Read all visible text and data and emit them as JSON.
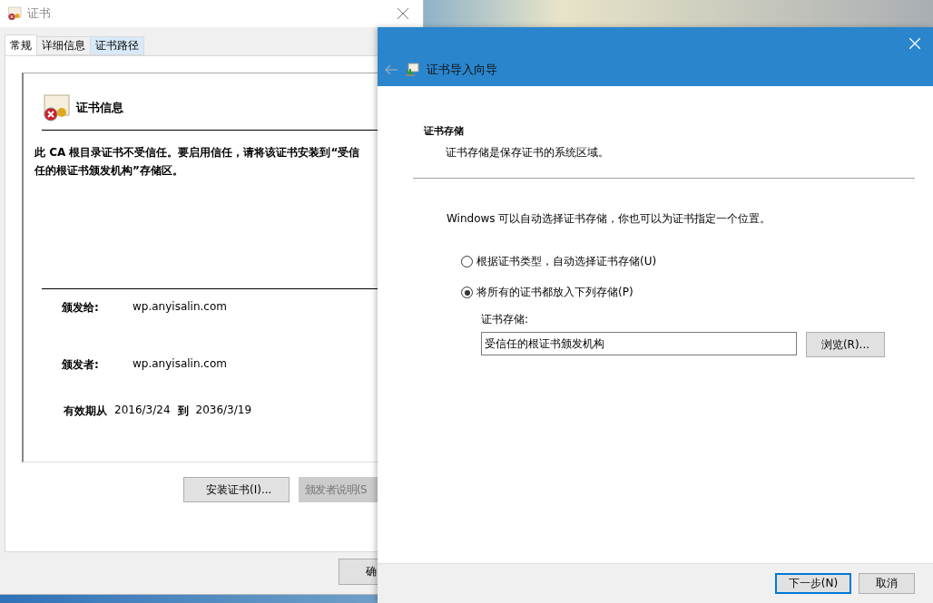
{
  "cert_window": {
    "title": "证书",
    "tabs": [
      {
        "label": "常规",
        "selected": true,
        "hovered": false
      },
      {
        "label": "详细信息",
        "selected": false,
        "hovered": false
      },
      {
        "label": "证书路径",
        "selected": false,
        "hovered": true
      }
    ],
    "heading": "证书信息",
    "message": "此 CA 根目录证书不受信任。要启用信任，请将该证书安装到“受信任的根证书颁发机构”存储区。",
    "fields": [
      {
        "label": "颁发给:",
        "value": "wp.anyisalin.com"
      },
      {
        "label": "颁发者:",
        "value": "wp.anyisalin.com"
      }
    ],
    "validity": {
      "label": "有效期从",
      "from": "2016/3/24",
      "to_label": "到",
      "to": "2036/3/19"
    },
    "buttons": [
      {
        "label": "安装证书(I)...",
        "disabled": false
      },
      {
        "label": "颁发者说明(S",
        "disabled": true
      }
    ],
    "ok_button": "确"
  },
  "wizard": {
    "title": "证书导入向导",
    "section_title": "证书存储",
    "section_description": "证书存储是保存证书的系统区域。",
    "intro": "Windows 可以自动选择证书存储，你也可以为证书指定一个位置。",
    "options": [
      {
        "label": "根据证书类型，自动选择证书存储(U)",
        "selected": false
      },
      {
        "label": "将所有的证书都放入下列存储(P)",
        "selected": true
      }
    ],
    "store_label": "证书存储:",
    "store_value": "受信任的根证书颁发机构",
    "browse_button": "浏览(R)...",
    "footer_buttons": [
      {
        "label": "下一步(N)",
        "default": true
      },
      {
        "label": "取消",
        "default": false
      }
    ]
  }
}
